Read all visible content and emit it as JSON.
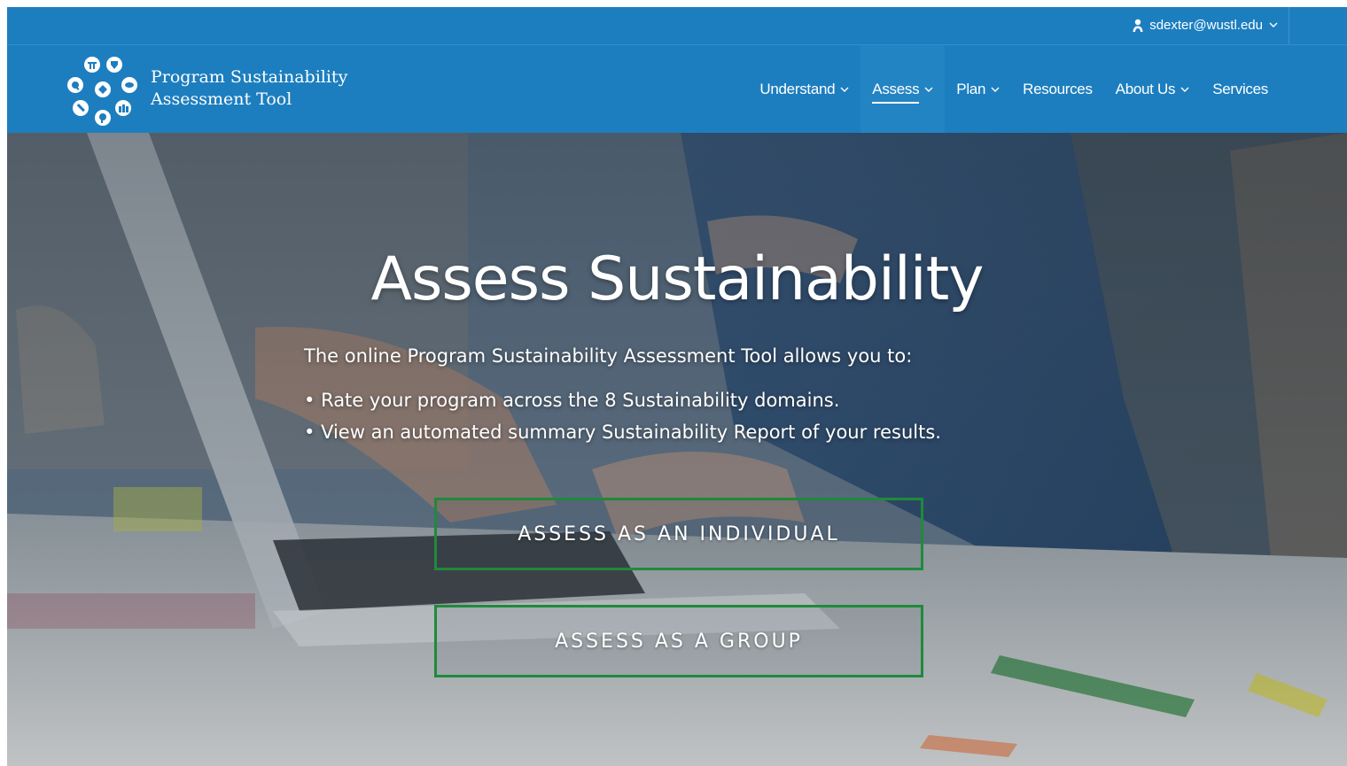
{
  "colors": {
    "header_bg": "#1c7ebf",
    "cta_border": "#1f8a3b",
    "text": "#ffffff"
  },
  "utility": {
    "user_email": "sdexter@wustl.edu",
    "user_icon": "person-icon"
  },
  "brand": {
    "line1": "Program Sustainability",
    "line2": "Assessment Tool",
    "logo_icon": "domain-circles-logo"
  },
  "nav": {
    "items": [
      {
        "label": "Understand",
        "dropdown": true,
        "active": false
      },
      {
        "label": "Assess",
        "dropdown": true,
        "active": true
      },
      {
        "label": "Plan",
        "dropdown": true,
        "active": false
      },
      {
        "label": "Resources",
        "dropdown": false,
        "active": false
      },
      {
        "label": "About Us",
        "dropdown": true,
        "active": false
      },
      {
        "label": "Services",
        "dropdown": false,
        "active": false
      }
    ]
  },
  "hero": {
    "title": "Assess Sustainability",
    "intro": "The online Program Sustainability Assessment Tool allows you to:",
    "bullets": [
      "Rate your program across the 8 Sustainability domains.",
      "View an automated summary Sustainability Report of your results."
    ],
    "cta_individual": "ASSESS AS AN INDIVIDUAL",
    "cta_group": "ASSESS AS A GROUP"
  }
}
